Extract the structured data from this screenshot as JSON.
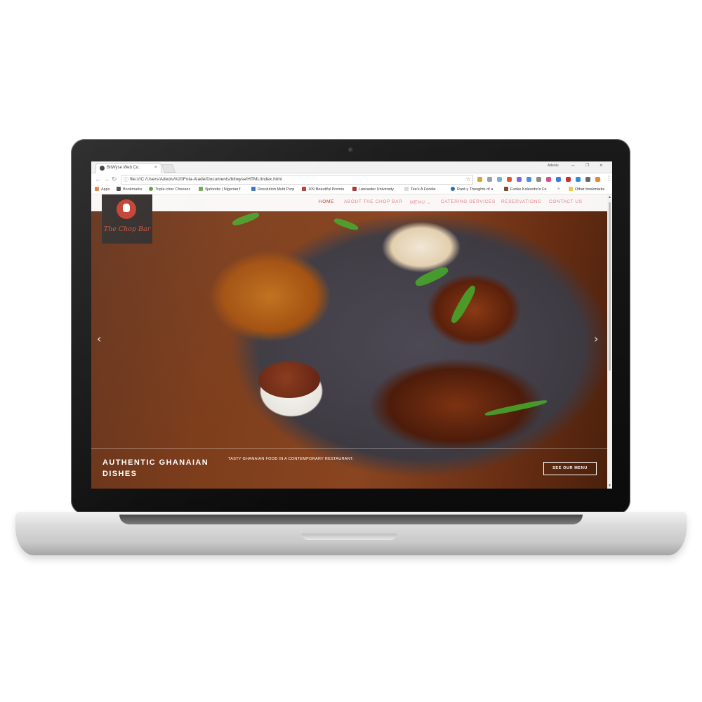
{
  "browser": {
    "tab_title": "BitWyse Web Co.",
    "user_name": "Adeolu",
    "url": "file:///C:/Users/Adeolu%20Fola-Alade/Documents/bitwyse/HTML/index.html",
    "bookmarks": [
      "Apps",
      "Bookmarks",
      "Triple-choc Cheesec",
      "9jafoodie | Nigerian f",
      "Resolution Multi Purp",
      "109 Beautiful Premiu",
      "Lancaster University",
      "Tee's A Foodie",
      "Rant-y Thoughts of a",
      "Funke Koleosho's Fo",
      "Other bookmarks"
    ],
    "overflow_label": "»"
  },
  "site": {
    "logo_text": "The Chop Bar",
    "nav": [
      "HOME",
      "ABOUT THE CHOP BAR",
      "MENU",
      "CATERING SERVICES",
      "RESERVATIONS",
      "CONTACT US"
    ],
    "active_nav": "HOME",
    "accent_color": "#c0392b",
    "nav_color": "#e2848a"
  },
  "hero": {
    "title": "AUTHENTIC GHANAIAN DISHES",
    "subtitle": "TASTY GHANAIAN FOOD IN A CONTEMPORARY RESTAURANT.",
    "cta_label": "SEE OUR MENU",
    "prev_arrow": "‹",
    "next_arrow": "›"
  }
}
